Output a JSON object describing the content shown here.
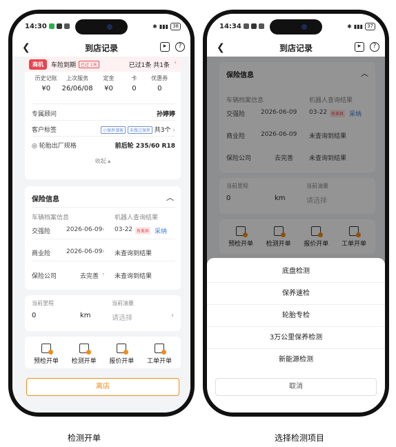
{
  "left_screen": {
    "status": {
      "time": "14:30",
      "battery": "38"
    },
    "nav": {
      "title": "到店记录"
    },
    "top_card": {
      "tag": "商机",
      "title": "车险到期",
      "overdue": "已过 1天",
      "summary": "已过1条 共1条",
      "stats": [
        {
          "label": "历史记账",
          "value": "¥0"
        },
        {
          "label": "上次服务",
          "value": "26/06/08"
        },
        {
          "label": "定金",
          "value": "¥0"
        },
        {
          "label": "卡",
          "value": "0"
        },
        {
          "label": "优惠券",
          "value": "0"
        }
      ],
      "advisor_label": "专属顾问",
      "advisor_value": "孙婷婷",
      "customer_tag_label": "客户标签",
      "tag_a": "小保养潜客",
      "tag_b": "未做过保养",
      "tag_count": "共3个",
      "tire_label": "轮胎出厂规格",
      "tire_value": "前后轮 235/60 R18",
      "collapse": "收起"
    },
    "insurance": {
      "title": "保险信息",
      "col_a": "车辆档案信息",
      "col_b": "机器人查询结果",
      "rows": [
        {
          "label": "交强险",
          "value": "2026-06-09",
          "result": "03-22",
          "badge": "有差异",
          "action": "采纳"
        },
        {
          "label": "商业险",
          "value": "2026-06-09",
          "result": "未查询到结果"
        },
        {
          "label": "保险公司",
          "value": "去完善",
          "result": "未查询到结果"
        }
      ]
    },
    "mileage": {
      "label_a": "当前里程",
      "value_a": "0",
      "unit": "km",
      "label_b": "当前油量",
      "placeholder_b": "请选择"
    },
    "tools": [
      "预检开单",
      "检测开单",
      "报价开单",
      "工单开单"
    ],
    "leave": "离店"
  },
  "right_screen": {
    "status": {
      "time": "14:34",
      "battery": "37"
    },
    "sheet_items": [
      "底盘检测",
      "保养速检",
      "轮胎专检",
      "3万公里保养检测",
      "新能源检测"
    ],
    "cancel": "取消"
  },
  "captions": {
    "left": "检测开单",
    "right": "选择检测项目"
  },
  "colors": {
    "accent": "#f08c1b",
    "danger": "#e8464e",
    "link": "#3d79d8"
  }
}
